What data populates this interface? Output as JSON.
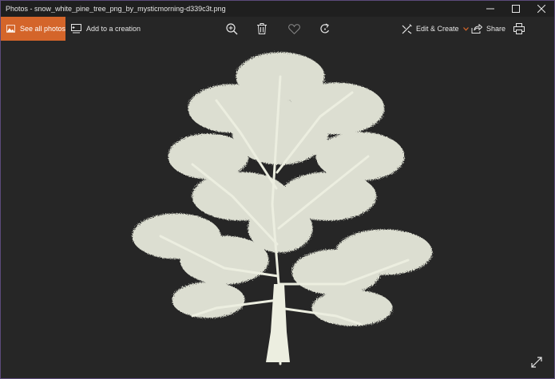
{
  "window": {
    "title": "Photos - snow_white_pine_tree_png_by_mysticmorning-d339c3t.png",
    "controls": [
      "minimize-icon",
      "maximize-icon",
      "close-icon"
    ]
  },
  "toolbar": {
    "see_all_label": "See all photos",
    "add_creation_label": "Add to a creation",
    "center_icons": [
      "zoom-in-icon",
      "delete-icon",
      "favorite-icon",
      "rotate-icon"
    ],
    "edit_create_label": "Edit & Create",
    "share_label": "Share",
    "print_icon": "print-icon"
  },
  "colors": {
    "accent": "#d4652a",
    "background": "#262626",
    "titlebar": "#1f1f1f",
    "tree": "#eceee0"
  },
  "canvas": {
    "fullscreen_icon": "fullscreen-icon"
  }
}
